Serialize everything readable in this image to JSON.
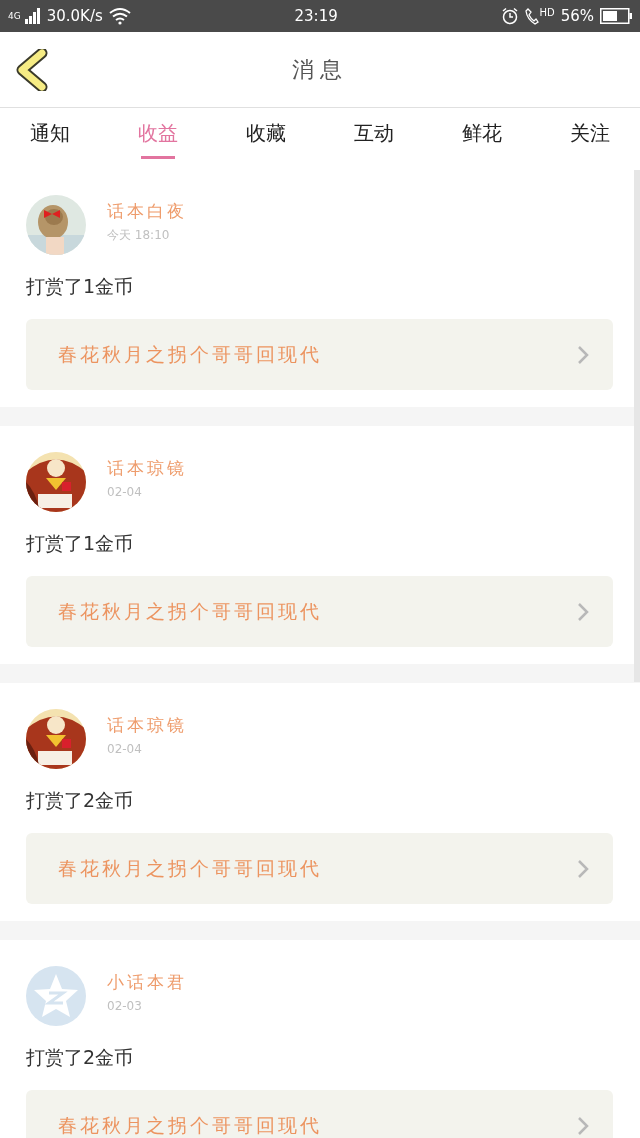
{
  "status_bar": {
    "network": "4G",
    "speed": "30.0K/s",
    "time": "23:19",
    "hd": "HD",
    "battery": "56%"
  },
  "header": {
    "title": "消息"
  },
  "tabs": [
    {
      "label": "通知",
      "selected": false
    },
    {
      "label": "收益",
      "selected": true
    },
    {
      "label": "收藏",
      "selected": false
    },
    {
      "label": "互动",
      "selected": false
    },
    {
      "label": "鲜花",
      "selected": false
    },
    {
      "label": "关注",
      "selected": false
    }
  ],
  "messages": [
    {
      "name": "话本白夜",
      "time": "今天 18:10",
      "text": "打赏了1金币",
      "book": "春花秋月之拐个哥哥回现代"
    },
    {
      "name": "话本琼镜",
      "time": "02-04",
      "text": "打赏了1金币",
      "book": "春花秋月之拐个哥哥回现代"
    },
    {
      "name": "话本琼镜",
      "time": "02-04",
      "text": "打赏了2金币",
      "book": "春花秋月之拐个哥哥回现代"
    },
    {
      "avatar": {
        "kind": "star"
      },
      "name": "小话本君",
      "time": "02-03",
      "text": "打赏了2金币",
      "book": "春花秋月之拐个哥哥回现代"
    }
  ]
}
